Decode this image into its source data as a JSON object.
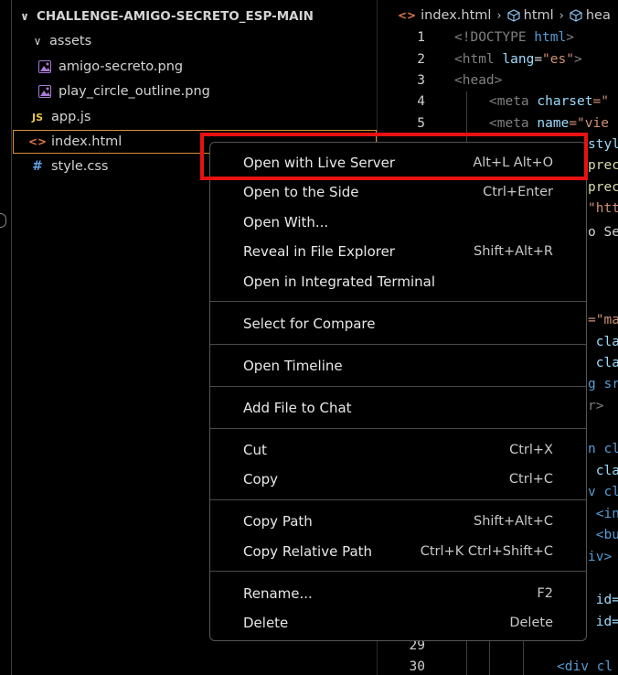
{
  "explorer": {
    "root_label": "CHALLENGE-AMIGO-SECRETO_ESP-MAIN",
    "folders": [
      {
        "label": "assets"
      }
    ],
    "files": [
      {
        "label": "amigo-secreto.png",
        "icon": "image-file-icon"
      },
      {
        "label": "play_circle_outline.png",
        "icon": "image-file-icon"
      },
      {
        "label": "app.js",
        "icon": "js-file-icon",
        "glyph": "JS"
      },
      {
        "label": "index.html",
        "icon": "html-file-icon",
        "glyph": "<>"
      },
      {
        "label": "style.css",
        "icon": "css-file-icon",
        "glyph": "#"
      }
    ]
  },
  "editor": {
    "breadcrumb": [
      "index.html",
      "html",
      "hea"
    ],
    "line_numbers": [
      "1",
      "2",
      "3",
      "4",
      "5",
      "29",
      "30"
    ],
    "code": {
      "l1_a": "<!DOCTYPE",
      "l1_b": " html",
      "l1_c": ">",
      "l2_a": "<html",
      "l2_b": " lang",
      "l2_c": "=",
      "l2_d": "\"es\"",
      "l2_e": ">",
      "l3_a": "<head>",
      "l4_a": "<meta",
      "l4_b": " charset",
      "l4_c": "=\"",
      "l5_a": "<meta",
      "l5_b": " name",
      "l5_c": "=\"vie",
      "r1": "styl",
      "r2": "preco",
      "r3": "preco",
      "r4": "\"htt",
      "r5": "o Se",
      "r6": "=\"ma",
      "r7": " cla",
      "r8": " cla",
      "r9": "g sr",
      "r10": "r>",
      "r11": "n cl",
      "r12": " cla",
      "r13": "v cl",
      "r14": " <in",
      "r15": " <bu",
      "r16": "iv>",
      "r17": " id=",
      "r18": " id=",
      "l30": "<div cl"
    }
  },
  "context_menu": {
    "groups": [
      [
        {
          "label": "Open with Live Server",
          "shortcut": "Alt+L Alt+O"
        },
        {
          "label": "Open to the Side",
          "shortcut": "Ctrl+Enter"
        },
        {
          "label": "Open With...",
          "shortcut": ""
        },
        {
          "label": "Reveal in File Explorer",
          "shortcut": "Shift+Alt+R"
        },
        {
          "label": "Open in Integrated Terminal",
          "shortcut": ""
        }
      ],
      [
        {
          "label": "Select for Compare",
          "shortcut": ""
        }
      ],
      [
        {
          "label": "Open Timeline",
          "shortcut": ""
        }
      ],
      [
        {
          "label": "Add File to Chat",
          "shortcut": ""
        }
      ],
      [
        {
          "label": "Cut",
          "shortcut": "Ctrl+X"
        },
        {
          "label": "Copy",
          "shortcut": "Ctrl+C"
        }
      ],
      [
        {
          "label": "Copy Path",
          "shortcut": "Shift+Alt+C"
        },
        {
          "label": "Copy Relative Path",
          "shortcut": "Ctrl+K Ctrl+Shift+C"
        }
      ],
      [
        {
          "label": "Rename...",
          "shortcut": "F2"
        },
        {
          "label": "Delete",
          "shortcut": "Delete"
        }
      ]
    ]
  },
  "colors": {
    "highlight": "#e81212",
    "selected_outline": "#d8903a",
    "html_icon": "#e07a48",
    "js_icon": "#e6c641",
    "css_icon": "#5fa3e6"
  }
}
